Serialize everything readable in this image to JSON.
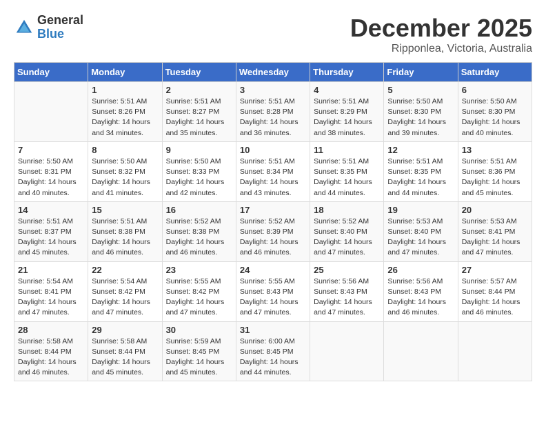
{
  "header": {
    "logo_line1": "General",
    "logo_line2": "Blue",
    "month": "December 2025",
    "location": "Ripponlea, Victoria, Australia"
  },
  "days_of_week": [
    "Sunday",
    "Monday",
    "Tuesday",
    "Wednesday",
    "Thursday",
    "Friday",
    "Saturday"
  ],
  "weeks": [
    [
      {
        "day": "",
        "text": ""
      },
      {
        "day": "1",
        "text": "Sunrise: 5:51 AM\nSunset: 8:26 PM\nDaylight: 14 hours\nand 34 minutes."
      },
      {
        "day": "2",
        "text": "Sunrise: 5:51 AM\nSunset: 8:27 PM\nDaylight: 14 hours\nand 35 minutes."
      },
      {
        "day": "3",
        "text": "Sunrise: 5:51 AM\nSunset: 8:28 PM\nDaylight: 14 hours\nand 36 minutes."
      },
      {
        "day": "4",
        "text": "Sunrise: 5:51 AM\nSunset: 8:29 PM\nDaylight: 14 hours\nand 38 minutes."
      },
      {
        "day": "5",
        "text": "Sunrise: 5:50 AM\nSunset: 8:30 PM\nDaylight: 14 hours\nand 39 minutes."
      },
      {
        "day": "6",
        "text": "Sunrise: 5:50 AM\nSunset: 8:30 PM\nDaylight: 14 hours\nand 40 minutes."
      }
    ],
    [
      {
        "day": "7",
        "text": "Sunrise: 5:50 AM\nSunset: 8:31 PM\nDaylight: 14 hours\nand 40 minutes."
      },
      {
        "day": "8",
        "text": "Sunrise: 5:50 AM\nSunset: 8:32 PM\nDaylight: 14 hours\nand 41 minutes."
      },
      {
        "day": "9",
        "text": "Sunrise: 5:50 AM\nSunset: 8:33 PM\nDaylight: 14 hours\nand 42 minutes."
      },
      {
        "day": "10",
        "text": "Sunrise: 5:51 AM\nSunset: 8:34 PM\nDaylight: 14 hours\nand 43 minutes."
      },
      {
        "day": "11",
        "text": "Sunrise: 5:51 AM\nSunset: 8:35 PM\nDaylight: 14 hours\nand 44 minutes."
      },
      {
        "day": "12",
        "text": "Sunrise: 5:51 AM\nSunset: 8:35 PM\nDaylight: 14 hours\nand 44 minutes."
      },
      {
        "day": "13",
        "text": "Sunrise: 5:51 AM\nSunset: 8:36 PM\nDaylight: 14 hours\nand 45 minutes."
      }
    ],
    [
      {
        "day": "14",
        "text": "Sunrise: 5:51 AM\nSunset: 8:37 PM\nDaylight: 14 hours\nand 45 minutes."
      },
      {
        "day": "15",
        "text": "Sunrise: 5:51 AM\nSunset: 8:38 PM\nDaylight: 14 hours\nand 46 minutes."
      },
      {
        "day": "16",
        "text": "Sunrise: 5:52 AM\nSunset: 8:38 PM\nDaylight: 14 hours\nand 46 minutes."
      },
      {
        "day": "17",
        "text": "Sunrise: 5:52 AM\nSunset: 8:39 PM\nDaylight: 14 hours\nand 46 minutes."
      },
      {
        "day": "18",
        "text": "Sunrise: 5:52 AM\nSunset: 8:40 PM\nDaylight: 14 hours\nand 47 minutes."
      },
      {
        "day": "19",
        "text": "Sunrise: 5:53 AM\nSunset: 8:40 PM\nDaylight: 14 hours\nand 47 minutes."
      },
      {
        "day": "20",
        "text": "Sunrise: 5:53 AM\nSunset: 8:41 PM\nDaylight: 14 hours\nand 47 minutes."
      }
    ],
    [
      {
        "day": "21",
        "text": "Sunrise: 5:54 AM\nSunset: 8:41 PM\nDaylight: 14 hours\nand 47 minutes."
      },
      {
        "day": "22",
        "text": "Sunrise: 5:54 AM\nSunset: 8:42 PM\nDaylight: 14 hours\nand 47 minutes."
      },
      {
        "day": "23",
        "text": "Sunrise: 5:55 AM\nSunset: 8:42 PM\nDaylight: 14 hours\nand 47 minutes."
      },
      {
        "day": "24",
        "text": "Sunrise: 5:55 AM\nSunset: 8:43 PM\nDaylight: 14 hours\nand 47 minutes."
      },
      {
        "day": "25",
        "text": "Sunrise: 5:56 AM\nSunset: 8:43 PM\nDaylight: 14 hours\nand 47 minutes."
      },
      {
        "day": "26",
        "text": "Sunrise: 5:56 AM\nSunset: 8:43 PM\nDaylight: 14 hours\nand 46 minutes."
      },
      {
        "day": "27",
        "text": "Sunrise: 5:57 AM\nSunset: 8:44 PM\nDaylight: 14 hours\nand 46 minutes."
      }
    ],
    [
      {
        "day": "28",
        "text": "Sunrise: 5:58 AM\nSunset: 8:44 PM\nDaylight: 14 hours\nand 46 minutes."
      },
      {
        "day": "29",
        "text": "Sunrise: 5:58 AM\nSunset: 8:44 PM\nDaylight: 14 hours\nand 45 minutes."
      },
      {
        "day": "30",
        "text": "Sunrise: 5:59 AM\nSunset: 8:45 PM\nDaylight: 14 hours\nand 45 minutes."
      },
      {
        "day": "31",
        "text": "Sunrise: 6:00 AM\nSunset: 8:45 PM\nDaylight: 14 hours\nand 44 minutes."
      },
      {
        "day": "",
        "text": ""
      },
      {
        "day": "",
        "text": ""
      },
      {
        "day": "",
        "text": ""
      }
    ]
  ]
}
